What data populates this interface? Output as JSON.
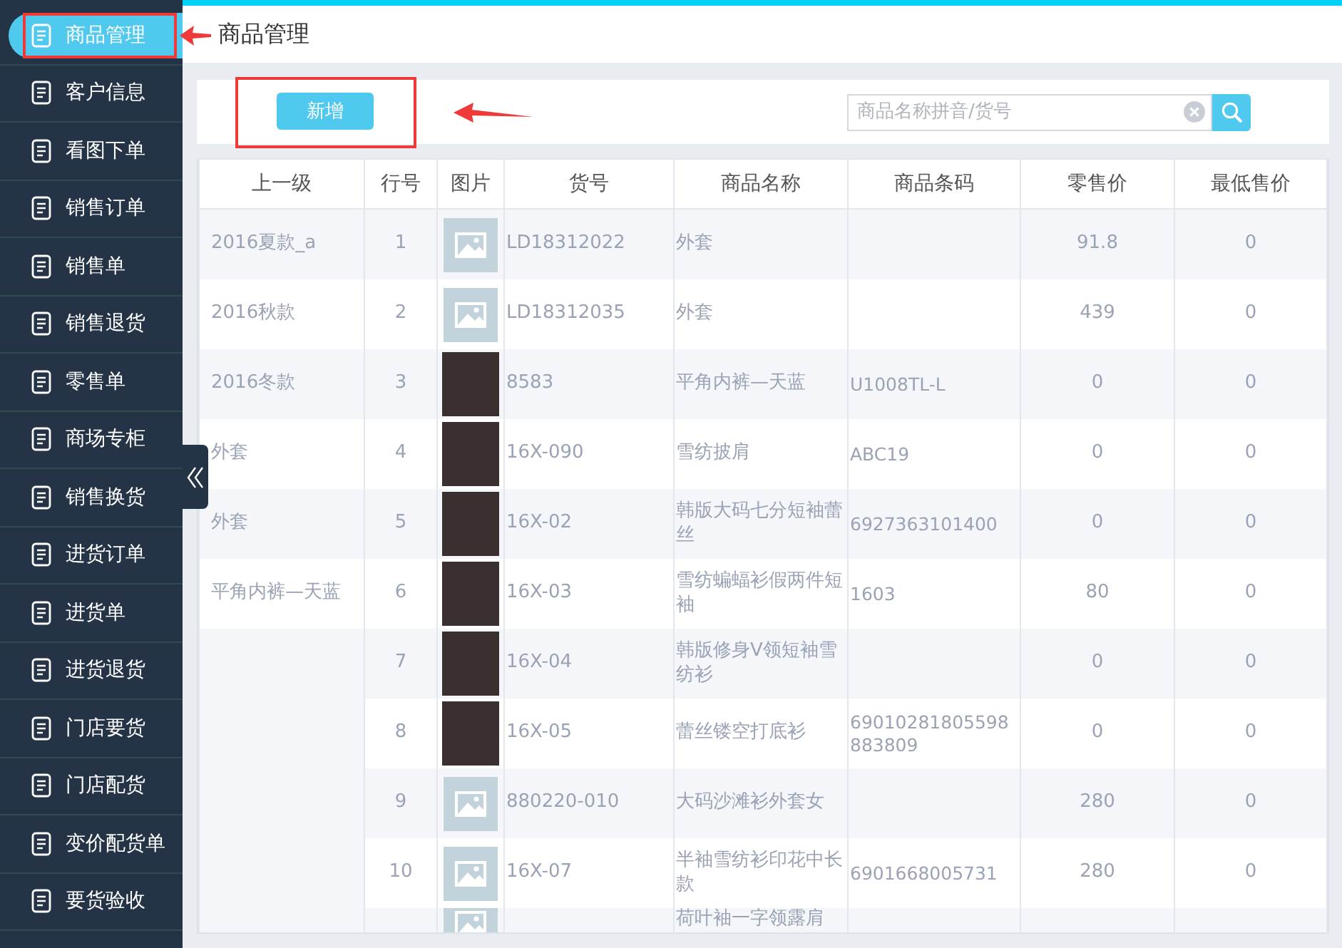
{
  "header": {
    "title": "商品管理"
  },
  "sidebar": {
    "items": [
      {
        "label": "商品管理",
        "selected": true
      },
      {
        "label": "客户信息",
        "selected": false
      },
      {
        "label": "看图下单",
        "selected": false
      },
      {
        "label": "销售订单",
        "selected": false
      },
      {
        "label": "销售单",
        "selected": false
      },
      {
        "label": "销售退货",
        "selected": false
      },
      {
        "label": "零售单",
        "selected": false
      },
      {
        "label": "商场专柜",
        "selected": false
      },
      {
        "label": "销售换货",
        "selected": false
      },
      {
        "label": "进货订单",
        "selected": false
      },
      {
        "label": "进货单",
        "selected": false
      },
      {
        "label": "进货退货",
        "selected": false
      },
      {
        "label": "门店要货",
        "selected": false
      },
      {
        "label": "门店配货",
        "selected": false
      },
      {
        "label": "变价配货单",
        "selected": false
      },
      {
        "label": "要货验收",
        "selected": false
      }
    ]
  },
  "toolbar": {
    "add_button": "新增",
    "search": {
      "placeholder": "商品名称拼音/货号"
    }
  },
  "table": {
    "columns": [
      "上一级",
      "行号",
      "图片",
      "货号",
      "商品名称",
      "商品条码",
      "零售价",
      "最低售价"
    ],
    "rows": [
      {
        "parent": "2016夏款_a",
        "row_number": "1",
        "kind": "placeholder",
        "code": "LD18312022",
        "name": "外套",
        "retail_price": "91.8",
        "min_price": "0"
      },
      {
        "parent": "2016秋款",
        "row_number": "2",
        "kind": "placeholder",
        "code": "LD18312035",
        "name": "外套",
        "retail_price": "439",
        "min_price": "0"
      },
      {
        "parent": "2016冬款",
        "row_number": "3",
        "kind": "photo",
        "code": "8583",
        "name": "平角内裤—天蓝",
        "barcode": "U1008TL-L",
        "retail_price": "0",
        "min_price": "0"
      },
      {
        "parent": "外套",
        "row_number": "4",
        "kind": "photo",
        "code": "16X-090",
        "name": "雪纺披肩",
        "barcode": "ABC19",
        "retail_price": "0",
        "min_price": "0"
      },
      {
        "parent": "外套",
        "row_number": "5",
        "kind": "photo",
        "code": "16X-02",
        "name": "韩版大码七分短袖蕾丝",
        "barcode": "6927363101400",
        "retail_price": "0",
        "min_price": "0"
      },
      {
        "parent": "平角内裤—天蓝",
        "row_number": "6",
        "kind": "photo",
        "code": "16X-03",
        "name": "雪纺蝙蝠衫假两件短袖",
        "barcode": "1603",
        "retail_price": "80",
        "min_price": "0"
      },
      {
        "row_number": "7",
        "kind": "photo",
        "code": "16X-04",
        "name": "韩版修身V领短袖雪纺衫",
        "retail_price": "0",
        "min_price": "0"
      },
      {
        "row_number": "8",
        "kind": "photo",
        "code": "16X-05",
        "name": "蕾丝镂空打底衫",
        "barcode": "69010281805598883809",
        "retail_price": "0",
        "min_price": "0"
      },
      {
        "row_number": "9",
        "kind": "placeholder",
        "code": "880220-010",
        "name": "大码沙滩衫外套女",
        "retail_price": "280",
        "min_price": "0"
      },
      {
        "row_number": "10",
        "kind": "placeholder",
        "code": "16X-07",
        "name": "半袖雪纺衫印花中长款",
        "barcode": "6901668005731",
        "retail_price": "280",
        "min_price": "0"
      },
      {
        "kind": "placeholder",
        "name": "荷叶袖一字领露肩"
      }
    ]
  }
}
